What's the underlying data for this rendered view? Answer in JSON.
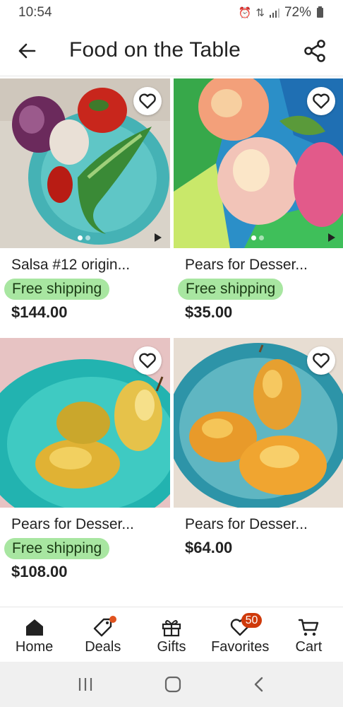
{
  "status_bar": {
    "time": "10:54",
    "battery": "72%"
  },
  "header": {
    "title": "Food on the Table"
  },
  "listings": [
    {
      "title": "Salsa #12 origin...",
      "free_shipping": "Free shipping",
      "price": "$144.00"
    },
    {
      "title": "Pears for Desser...",
      "free_shipping": "Free shipping",
      "price": "$35.00"
    },
    {
      "title": "Pears for Desser...",
      "free_shipping": "Free shipping",
      "price": "$108.00"
    },
    {
      "title": "Pears for Desser...",
      "price": "$64.00"
    }
  ],
  "bottom_nav": {
    "home": "Home",
    "deals": "Deals",
    "gifts": "Gifts",
    "favorites": "Favorites",
    "favorites_count": "50",
    "cart": "Cart"
  },
  "icons": [
    "back-arrow-icon",
    "share-icon",
    "heart-icon",
    "home-icon",
    "tag-icon",
    "gift-icon",
    "cart-icon"
  ],
  "colors": {
    "free_shipping_bg": "#a8e6a1",
    "badge": "#cf3a0b"
  }
}
